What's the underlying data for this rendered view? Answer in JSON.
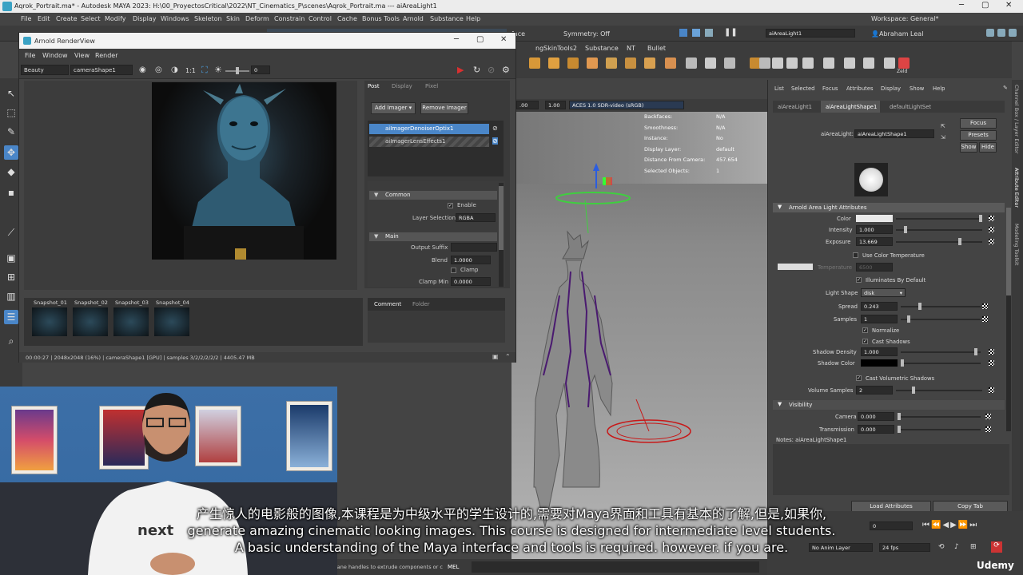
{
  "app": {
    "window_title": "Aqrok_Portrait.ma* - Autodesk MAYA 2023: H:\\00_ProyectosCritical\\2022\\NT_Cinematics_P\\scenes\\Aqrok_Portrait.ma  ---  aiAreaLight1",
    "menu": [
      "File",
      "Edit",
      "Create",
      "Select",
      "Modify",
      "Display",
      "Windows",
      "Skeleton",
      "Skin",
      "Deform",
      "Constrain",
      "Control",
      "Cache",
      "Bonus Tools",
      "Arnold",
      "Substance",
      "Help"
    ],
    "workspace_label": "Workspace: General*"
  },
  "status": {
    "symmetry": "Symmetry: Off",
    "face": "face",
    "object_name": "aiAreaLight1",
    "user": "Abraham Leal"
  },
  "shelf": {
    "tabs": [
      "ngSkinTools2",
      "Substance",
      "NT",
      "Bullet"
    ],
    "zeld": "Zeld"
  },
  "viewport": {
    "values": {
      "v1": ".00",
      "v2": "1.00",
      "colorspace": "ACES 1.0 SDR-video (sRGB)"
    },
    "hud": [
      {
        "label": "Backfaces:",
        "value": "N/A"
      },
      {
        "label": "Smoothness:",
        "value": "N/A"
      },
      {
        "label": "Instance:",
        "value": "No"
      },
      {
        "label": "Display Layer:",
        "value": "default"
      },
      {
        "label": "Distance From Camera:",
        "value": "457.654"
      },
      {
        "label": "Selected Objects:",
        "value": "1"
      }
    ]
  },
  "renderview": {
    "title": "Arnold RenderView",
    "menu": [
      "File",
      "Window",
      "View",
      "Render"
    ],
    "aov": "Beauty",
    "camera": "cameraShape1",
    "ratio": "1:1",
    "exposure": "0",
    "tabs": [
      "Post",
      "Display",
      "Pixel"
    ],
    "add_imager": "Add Imager",
    "remove_imager": "Remove Imager",
    "imagers": [
      "aiImagerDenoiserOptix1",
      "aiImagerLensEffects1"
    ],
    "common_label": "Common",
    "enable_label": "Enable",
    "layer_selection_label": "Layer Selection",
    "layer_selection_value": "RGBA",
    "main_label": "Main",
    "output_suffix_label": "Output Suffix",
    "blend_label": "Blend",
    "blend_value": "1.0000",
    "clamp_label": "Clamp",
    "clamp_min_label": "Clamp Min",
    "clamp_min_value": "0.0000",
    "snapshots": [
      "Snapshot_01",
      "Snapshot_02",
      "Snapshot_03",
      "Snapshot_04"
    ],
    "comment_tabs": [
      "Comment",
      "Folder"
    ],
    "status": "00:00:27 | 2048x2048 (16%) | cameraShape1 [GPU] | samples 3/2/2/2/2/2 | 4405.47 MB"
  },
  "attribute_editor": {
    "menu": [
      "List",
      "Selected",
      "Focus",
      "Attributes",
      "Display",
      "Show",
      "Help"
    ],
    "tabs": [
      "aiAreaLight1",
      "aiAreaLightShape1",
      "defaultLightSet"
    ],
    "node_label": "aiAreaLight:",
    "node_value": "aiAreaLightShape1",
    "buttons": {
      "focus": "Focus",
      "presets": "Presets",
      "show": "Show",
      "hide": "Hide"
    },
    "section_main": "Arnold Area Light Attributes",
    "color_label": "Color",
    "intensity_label": "Intensity",
    "intensity_value": "1.000",
    "exposure_label": "Exposure",
    "exposure_value": "13.669",
    "use_color_temp": "Use Color Temperature",
    "temperature_label": "Temperature",
    "temperature_value": "6500",
    "illuminates_default": "Illuminates By Default",
    "light_shape_label": "Light Shape",
    "light_shape_value": "disk",
    "spread_label": "Spread",
    "spread_value": "0.243",
    "samples_label": "Samples",
    "samples_value": "1",
    "normalize": "Normalize",
    "cast_shadows": "Cast Shadows",
    "shadow_density_label": "Shadow Density",
    "shadow_density_value": "1.000",
    "shadow_color_label": "Shadow Color",
    "cast_volumetric": "Cast Volumetric Shadows",
    "volume_samples_label": "Volume Samples",
    "volume_samples_value": "2",
    "section_visibility": "Visibility",
    "camera_label": "Camera",
    "camera_value": "0.000",
    "transmission_label": "Transmission",
    "transmission_value": "0.000",
    "notes": "Notes:  aiAreaLightShape1",
    "load_attributes": "Load Attributes",
    "copy_tab": "Copy Tab",
    "side_tabs": [
      "Channel Box / Layer Editor",
      "Attribute Editor",
      "Modeling Toolkit"
    ]
  },
  "timeline": {
    "frame": "0",
    "anim_layer": "No Anim Layer",
    "fps": "24 fps"
  },
  "command_line": {
    "hint": "lane handles to extrude components or c",
    "lang": "MEL"
  },
  "subtitles": [
    "产生惊人的电影般的图像,本课程是为中级水平的学生设计的,需要对Maya界面和工具有基本的了解,但是,如果你,",
    "generate amazing cinematic looking images. This course is designed for intermediate level students.",
    "A basic understanding of the Maya interface and tools is required. however. if you are."
  ],
  "watermark": "Udemy",
  "webcam_shirt_text": "next",
  "colors": {
    "accent": "#4a86c8",
    "record": "#d83030",
    "maya_bg": "#444444"
  }
}
